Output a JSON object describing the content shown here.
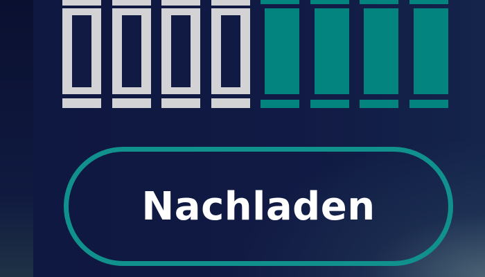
{
  "ammo": {
    "capacity": 8,
    "remaining": 4,
    "spent": 4,
    "colors": {
      "spent": "#d3d3d5",
      "remaining": "#03847f"
    }
  },
  "reload_button": {
    "label": "Nachladen",
    "border_color": "#10918d"
  },
  "theme": {
    "background": "#0f1840",
    "text": "#ffffff"
  }
}
